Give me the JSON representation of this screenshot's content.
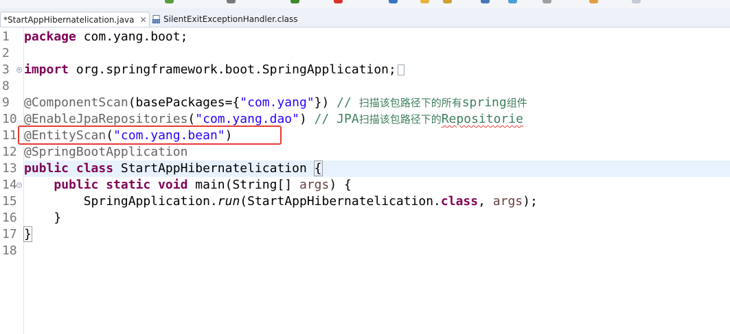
{
  "tabs": [
    {
      "label": "*StartAppHibernatelication.java",
      "close": "✕",
      "active": true
    },
    {
      "label": "SilentExitExceptionHandler.class",
      "active": false
    }
  ],
  "gutter": {
    "lines": [
      "1",
      "2",
      "3",
      "8",
      "9",
      "10",
      "11",
      "12",
      "13",
      "14",
      "15",
      "16",
      "17",
      "18"
    ]
  },
  "code": {
    "l1_kw": "package",
    "l1_rest": " com.yang.boot;",
    "l3_kw": "import",
    "l3_rest": " org.springframework.boot.SpringApplication;",
    "l9_ann": "@ComponentScan",
    "l9_a": "(basePackages={",
    "l9_str": "\"com.yang\"",
    "l9_b": "}) ",
    "l9_cmt": "// ",
    "l9_cmt_cjk": "扫描该包路径下的所有",
    "l9_cmt_spring": "spring",
    "l9_cmt_cjk2": "组件",
    "l10_ann": "@EnableJpaRepositories",
    "l10_a": "(",
    "l10_str": "\"com.yang.dao\"",
    "l10_b": ") ",
    "l10_cmt": "// JPA",
    "l10_cmt_cjk": "扫描该包路径下的",
    "l10_cmt_repo": "Repositorie",
    "l11_ann": "@EntityScan",
    "l11_a": "(",
    "l11_str": "\"com.yang.bean\"",
    "l11_b": ")",
    "l12_ann": "@SpringBootApplication",
    "l13_kw": "public class",
    "l13_rest": " StartAppHibernatelication ",
    "l13_brace": "{",
    "l14_kw": "public static void",
    "l14_a": " main(String[] ",
    "l14_arg": "args",
    "l14_b": ") {",
    "l15_a": "SpringApplication.",
    "l15_it": "run",
    "l15_b": "(StartAppHibernatelication.",
    "l15_kw": "class",
    "l15_c": ", ",
    "l15_arg": "args",
    "l15_d": ");",
    "l16": "}",
    "l17": "}"
  },
  "colors": {
    "keyword": "#7f0055",
    "string": "#2a00ff",
    "annotation": "#646464",
    "comment": "#3f7f5f",
    "highlight_box": "#e53935",
    "current_line": "#e8f2fe"
  }
}
